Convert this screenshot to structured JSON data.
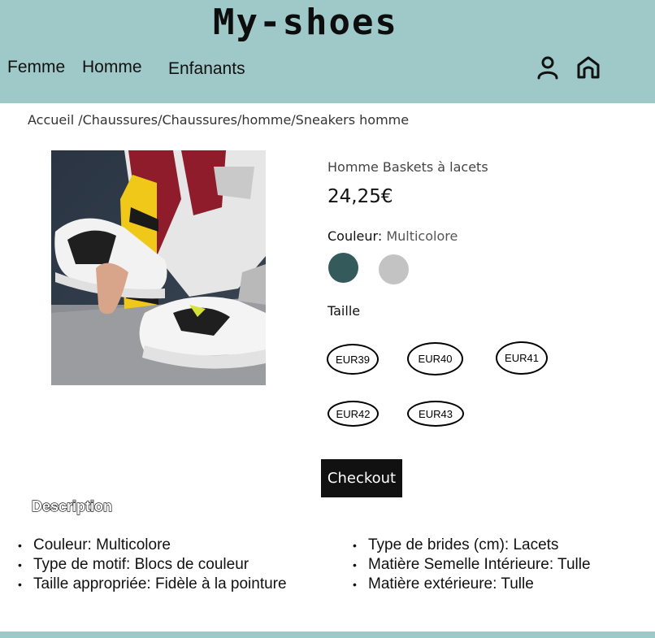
{
  "header": {
    "logo": "My-shoes",
    "nav": [
      "Femme",
      "Homme",
      "Enfanants"
    ],
    "icons": [
      "user-icon",
      "home-icon"
    ],
    "bg_color": "#9ec9c8"
  },
  "breadcrumb": "Accueil /Chaussures/Chaussures/homme/Sneakers homme",
  "product": {
    "title": "Homme Baskets à lacets",
    "price": "24,25€",
    "color_label": "Couleur:",
    "color_value": "Multicolore",
    "swatches": [
      "#355a5c",
      "#c3c3c3"
    ],
    "size_label": "Taille",
    "sizes": [
      "EUR39",
      "EUR40",
      "EUR41",
      "EUR42",
      "EUR43"
    ]
  },
  "checkout_label": "Checkout",
  "description": {
    "title": "Description",
    "left": [
      "Couleur: Multicolore",
      "Type de motif: Blocs de couleur",
      "Taille appropriée: Fidèle à la pointure"
    ],
    "right": [
      "Type de brides (cm): Lacets",
      "Matière Semelle Intérieure: Tulle",
      "Matière extérieure: Tulle"
    ]
  }
}
